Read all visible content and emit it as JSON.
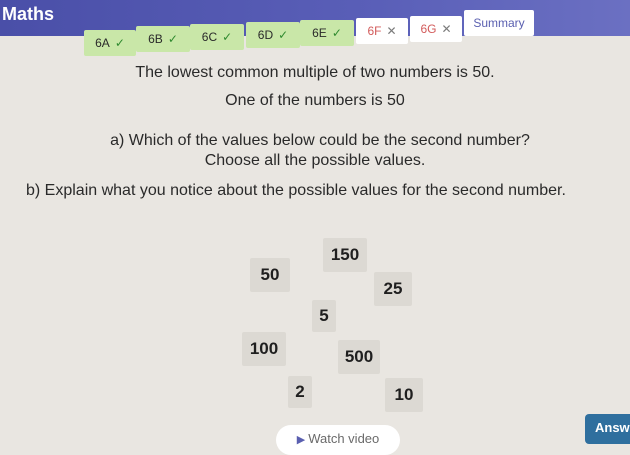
{
  "app": {
    "title": "Maths"
  },
  "tabs": [
    {
      "label": "6A",
      "mark": "✓",
      "status": "done"
    },
    {
      "label": "6B",
      "mark": "✓",
      "status": "done"
    },
    {
      "label": "6C",
      "mark": "✓",
      "status": "done"
    },
    {
      "label": "6D",
      "mark": "✓",
      "status": "done"
    },
    {
      "label": "6E",
      "mark": "✓",
      "status": "done"
    },
    {
      "label": "6F",
      "mark": "✕",
      "status": "todo"
    },
    {
      "label": "6G",
      "mark": "✕",
      "status": "todo"
    },
    {
      "label": "Summary",
      "mark": "",
      "status": "summary"
    }
  ],
  "question": {
    "line1": "The lowest common multiple of two numbers is 50.",
    "line2": "One of the numbers is 50",
    "part_a": "a) Which of the values below could be the second number?",
    "part_a_sub": "Choose all the possible values.",
    "part_b": "b) Explain what you notice about the possible values for the second number."
  },
  "cards": [
    "150",
    "50",
    "25",
    "5",
    "100",
    "500",
    "2",
    "10"
  ],
  "buttons": {
    "watch_video": "Watch video",
    "answer": "Answ"
  },
  "colors": {
    "header": "#4a4fa8",
    "tab_done": "#c9e7a8",
    "answer_button": "#2f6f9e"
  }
}
